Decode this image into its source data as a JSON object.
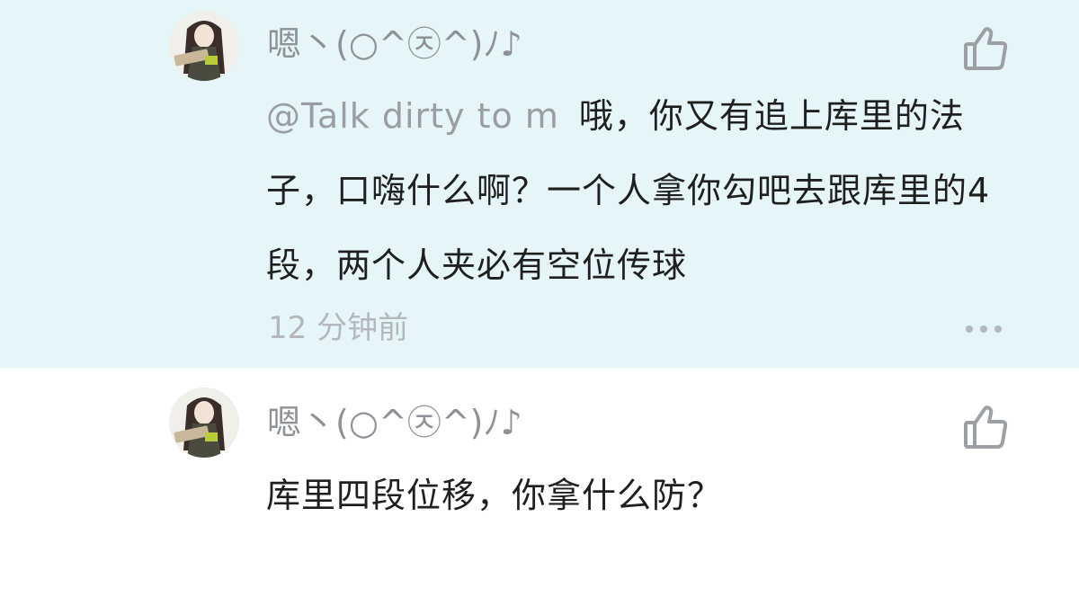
{
  "colors": {
    "highlight_background": "#e6f6f8",
    "username": "#8e9298",
    "content_text": "#1f1f1f",
    "mention_text": "#9a9da2",
    "time_text": "#b4b7bc",
    "icon_gray": "#9c9fa4"
  },
  "comments": [
    {
      "username": "嗯丶(○^㉨^)ﾉ♪",
      "mention": "@Talk dirty to m",
      "text": "哦，你又有追上库里的法子，口嗨什么啊？一个人拿你勾吧去跟库里的4段，两个人夹必有空位传球",
      "time": "12 分钟前",
      "icons": [
        "avatar",
        "thumbs-up-icon",
        "more-icon"
      ]
    },
    {
      "username": "嗯丶(○^㉨^)ﾉ♪",
      "text": "库里四段位移，你拿什么防？",
      "icons": [
        "avatar",
        "thumbs-up-icon"
      ]
    }
  ]
}
